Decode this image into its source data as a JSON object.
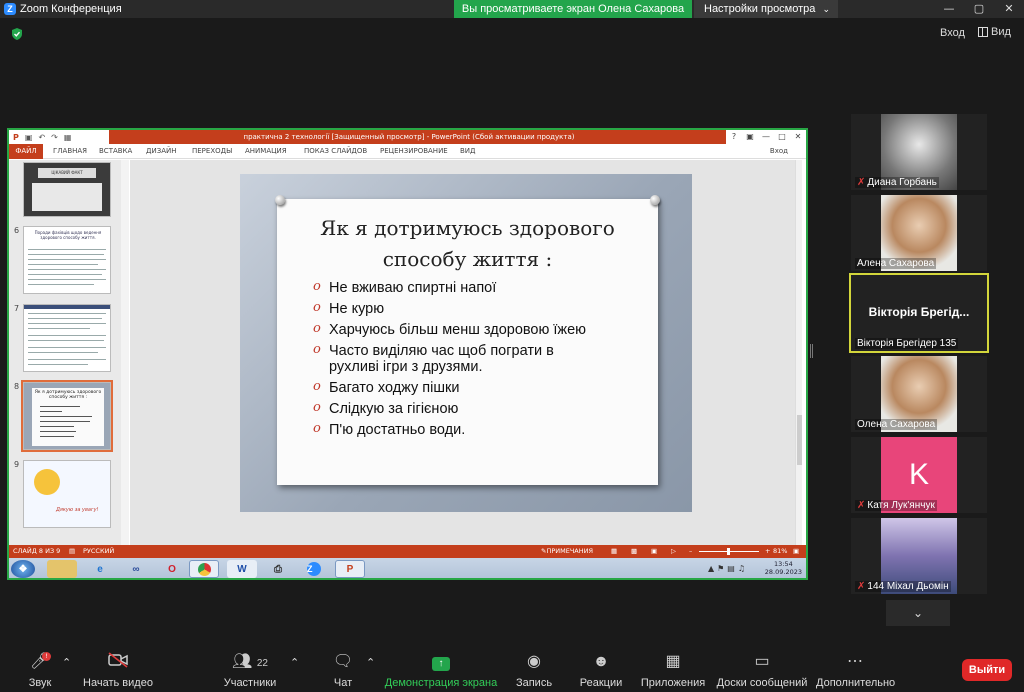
{
  "titlebar": {
    "app_title": "Zoom Конференция",
    "share_banner": "Вы просматриваете экран Олена Сахарова",
    "view_settings": "Настройки просмотра"
  },
  "topbar": {
    "exit_fullscreen": "Вход",
    "view": "Вид"
  },
  "ppt": {
    "window_title": "практична 2 технології [Защищенный просмотр] -  PowerPoint (Сбой активации продукта)",
    "file_tab": "ФАЙЛ",
    "tabs": [
      "ГЛАВНАЯ",
      "ВСТАВКА",
      "ДИЗАЙН",
      "ПЕРЕХОДЫ",
      "АНИМАЦИЯ",
      "ПОКАЗ СЛАЙДОВ",
      "РЕЦЕНЗИРОВАНИЕ",
      "ВИД"
    ],
    "login": "Вход",
    "thumbs": [
      {
        "num": "6"
      },
      {
        "num": "7"
      },
      {
        "num": "8"
      },
      {
        "num": "9"
      }
    ],
    "thumb5_title": "ЦІКАВИЙ ФАКТ",
    "thumb6_title": "Поради фахівців щодо ведення здорового способу життя.",
    "thumb8_title": "Як я дотримуюсь здорового способу життя :",
    "thumb9_text": "Дякую за увагу!",
    "slide": {
      "heading_line1": "Як я дотримуюсь здорового",
      "heading_line2": "способу життя :",
      "items": [
        "Не вживаю спиртні напої",
        "Не курю",
        "Харчуюсь більш менш здоровою їжею",
        "Часто виділяю час щоб пограти в рухливі ігри з друзями.",
        "Багато ходжу пішки",
        "Слідкую за гігієною",
        "П'ю  достатньо води."
      ]
    },
    "status": {
      "slide_info": "СЛАЙД 8 ИЗ 9",
      "language": "РУССКИЙ",
      "notes": "ПРИМЕЧАНИЯ",
      "zoom": "81%"
    },
    "tray": {
      "time": "13:54",
      "date": "28.09.2023"
    }
  },
  "participants": [
    {
      "name": "Диана Горбань",
      "muted": true,
      "photo_color": "#9a9a9a"
    },
    {
      "name": "Алена Сахарова",
      "muted": false,
      "photo_color": "#d8c2a8"
    },
    {
      "name": "Вікторія Брегідер 135",
      "big_name": "Вікторія  Брегід...",
      "muted": false,
      "active": true
    },
    {
      "name": "Олена Сахарова",
      "muted": false,
      "photo_color": "#d8c2a8"
    },
    {
      "name": "Катя Лук'янчук",
      "muted": true,
      "avatar_letter": "K",
      "avatar_color": "#e8457a"
    },
    {
      "name": "144 Міхал Дьомін",
      "muted": true,
      "photo_color": "#8a7fb0"
    }
  ],
  "toolbar": {
    "mic": "Звук",
    "mic_badge": "!",
    "video": "Начать видео",
    "participants": "Участники",
    "participants_count": "22",
    "chat": "Чат",
    "share": "Демонстрация экрана",
    "record": "Запись",
    "reactions": "Реакции",
    "apps": "Приложения",
    "whiteboards": "Доски сообщений",
    "more": "Дополнительно",
    "leave": "Выйти"
  },
  "colors": {
    "share_green": "#23a54c",
    "ppt_red": "#c43e1c",
    "leave_red": "#e02828",
    "active_speaker": "#d3d63b"
  }
}
